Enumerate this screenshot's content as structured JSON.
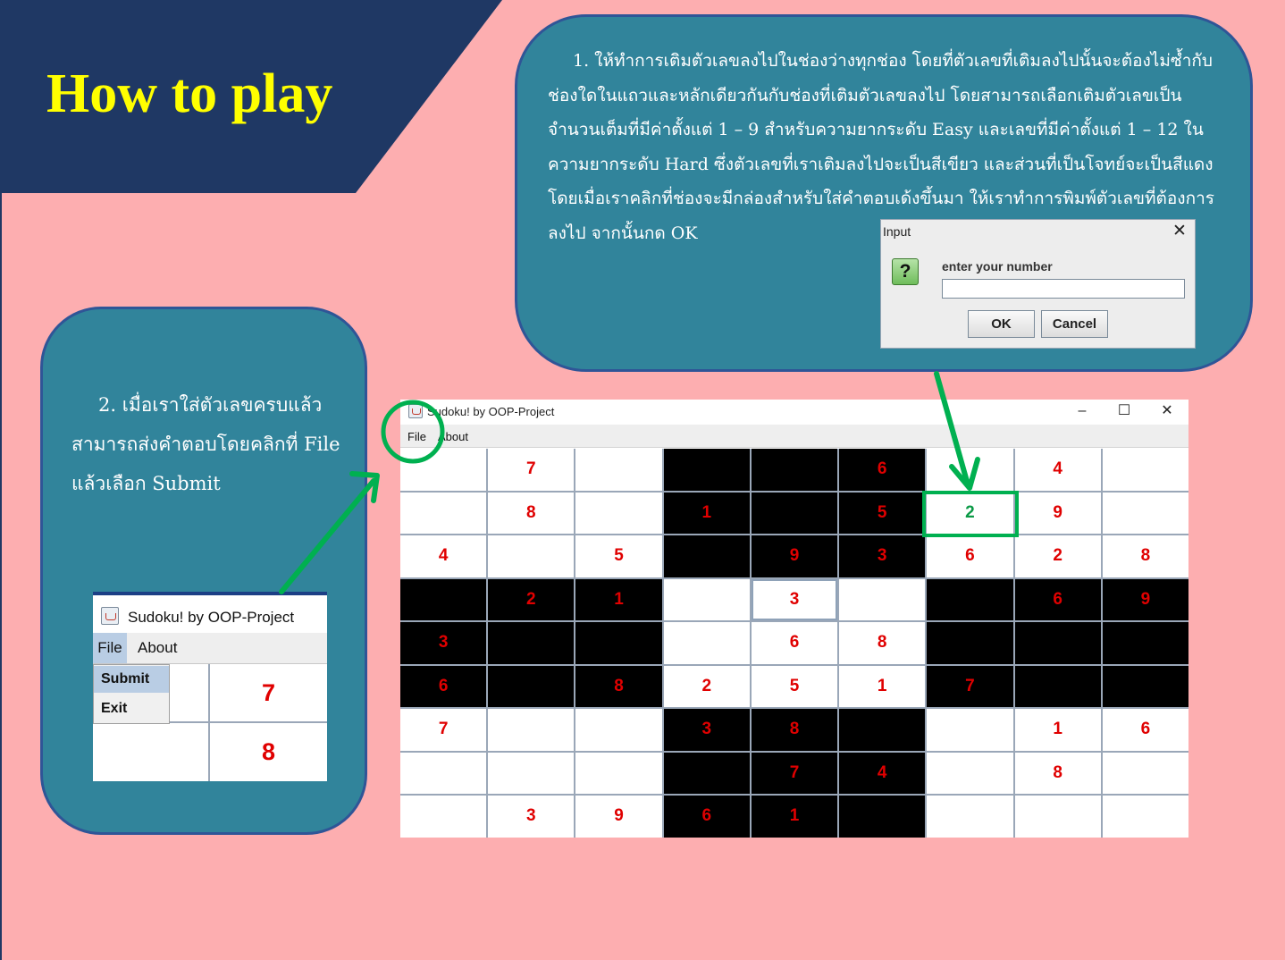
{
  "title": "How to play",
  "colors": {
    "background": "#fdaeb0",
    "banner": "#1f3864",
    "title": "#ffff00",
    "bubble": "#31849b",
    "clue_number": "#e00000",
    "player_number": "#0b9a46",
    "annotation": "#00b050"
  },
  "step1": {
    "text": "1. ให้ทำการเติมตัวเลขลงไปในช่องว่างทุกช่อง โดยที่ตัวเลขที่เติมลงไปนั้นจะต้องไม่ซ้ำกับช่องใดในแถวและหลักเดียวกันกับช่องที่เติมตัวเลขลงไป โดยสามารถเลือกเติมตัวเลขเป็นจำนวนเต็มที่มีค่าตั้งแต่ 1 – 9 สำหรับความยากระดับ Easy และเลขที่มีค่าตั้งแต่ 1 – 12 ในความยากระดับ Hard ซึ่งตัวเลขที่เราเติมลงไปจะเป็นสีเขียว และส่วนที่เป็นโจทย์จะเป็นสีแดง โดยเมื่อเราคลิกที่ช่องจะมีกล่องสำหรับใส่คำตอบเด้งขึ้นมา ให้เราทำการพิมพ์ตัวเลขที่ต้องการลงไป จากนั้นกด OK"
  },
  "step2": {
    "text": "2. เมื่อเราใส่ตัวเลขครบแล้ว สามารถส่งคำตอบโดยคลิกที่ File แล้วเลือก Submit"
  },
  "input_dialog": {
    "title": "Input",
    "close_icon": "close-icon",
    "question_icon": "?",
    "label": "enter your number",
    "value": "",
    "ok": "OK",
    "cancel": "Cancel"
  },
  "main_window": {
    "title": "Sudoku! by OOP-Project",
    "menu": [
      "File",
      "About"
    ],
    "controls": {
      "minimize": "–",
      "maximize": "☐",
      "close": "✕"
    },
    "selected_cell": [
      1,
      6
    ],
    "highlighted_cell": [
      3,
      4
    ],
    "grid": [
      [
        {
          "v": "",
          "b": 0
        },
        {
          "v": "7",
          "b": 0
        },
        {
          "v": "",
          "b": 0
        },
        {
          "v": "",
          "b": 1
        },
        {
          "v": "",
          "b": 1
        },
        {
          "v": "6",
          "b": 1
        },
        {
          "v": "",
          "b": 0
        },
        {
          "v": "4",
          "b": 0
        },
        {
          "v": "",
          "b": 0
        }
      ],
      [
        {
          "v": "",
          "b": 0
        },
        {
          "v": "8",
          "b": 0
        },
        {
          "v": "",
          "b": 0
        },
        {
          "v": "1",
          "b": 1
        },
        {
          "v": "",
          "b": 1
        },
        {
          "v": "5",
          "b": 1
        },
        {
          "v": "2",
          "b": 0,
          "player": 1
        },
        {
          "v": "9",
          "b": 0
        },
        {
          "v": "",
          "b": 0
        }
      ],
      [
        {
          "v": "4",
          "b": 0
        },
        {
          "v": "",
          "b": 0
        },
        {
          "v": "5",
          "b": 0
        },
        {
          "v": "",
          "b": 1
        },
        {
          "v": "9",
          "b": 1
        },
        {
          "v": "3",
          "b": 1
        },
        {
          "v": "6",
          "b": 0
        },
        {
          "v": "2",
          "b": 0
        },
        {
          "v": "8",
          "b": 0
        }
      ],
      [
        {
          "v": "",
          "b": 1
        },
        {
          "v": "2",
          "b": 1
        },
        {
          "v": "1",
          "b": 1
        },
        {
          "v": "",
          "b": 0
        },
        {
          "v": "3",
          "b": 0
        },
        {
          "v": "",
          "b": 0
        },
        {
          "v": "",
          "b": 1
        },
        {
          "v": "6",
          "b": 1
        },
        {
          "v": "9",
          "b": 1
        }
      ],
      [
        {
          "v": "3",
          "b": 1
        },
        {
          "v": "",
          "b": 1
        },
        {
          "v": "",
          "b": 1
        },
        {
          "v": "",
          "b": 0
        },
        {
          "v": "6",
          "b": 0
        },
        {
          "v": "8",
          "b": 0
        },
        {
          "v": "",
          "b": 1
        },
        {
          "v": "",
          "b": 1
        },
        {
          "v": "",
          "b": 1
        }
      ],
      [
        {
          "v": "6",
          "b": 1
        },
        {
          "v": "",
          "b": 1
        },
        {
          "v": "8",
          "b": 1
        },
        {
          "v": "2",
          "b": 0
        },
        {
          "v": "5",
          "b": 0
        },
        {
          "v": "1",
          "b": 0
        },
        {
          "v": "7",
          "b": 1
        },
        {
          "v": "",
          "b": 1
        },
        {
          "v": "",
          "b": 1
        }
      ],
      [
        {
          "v": "7",
          "b": 0
        },
        {
          "v": "",
          "b": 0
        },
        {
          "v": "",
          "b": 0
        },
        {
          "v": "3",
          "b": 1
        },
        {
          "v": "8",
          "b": 1
        },
        {
          "v": "",
          "b": 1
        },
        {
          "v": "",
          "b": 0
        },
        {
          "v": "1",
          "b": 0
        },
        {
          "v": "6",
          "b": 0
        }
      ],
      [
        {
          "v": "",
          "b": 0
        },
        {
          "v": "",
          "b": 0
        },
        {
          "v": "",
          "b": 0
        },
        {
          "v": "",
          "b": 1
        },
        {
          "v": "7",
          "b": 1
        },
        {
          "v": "4",
          "b": 1
        },
        {
          "v": "",
          "b": 0
        },
        {
          "v": "8",
          "b": 0
        },
        {
          "v": "",
          "b": 0
        }
      ],
      [
        {
          "v": "",
          "b": 0
        },
        {
          "v": "3",
          "b": 0
        },
        {
          "v": "9",
          "b": 0
        },
        {
          "v": "6",
          "b": 1
        },
        {
          "v": "1",
          "b": 1
        },
        {
          "v": "",
          "b": 1
        },
        {
          "v": "",
          "b": 0
        },
        {
          "v": "",
          "b": 0
        },
        {
          "v": "",
          "b": 0
        }
      ]
    ]
  },
  "small_window": {
    "title": "Sudoku! by OOP-Project",
    "menu_file": "File",
    "menu_about": "About",
    "dropdown": [
      "Submit",
      "Exit"
    ],
    "cells": [
      "",
      "7",
      "",
      "8"
    ]
  }
}
